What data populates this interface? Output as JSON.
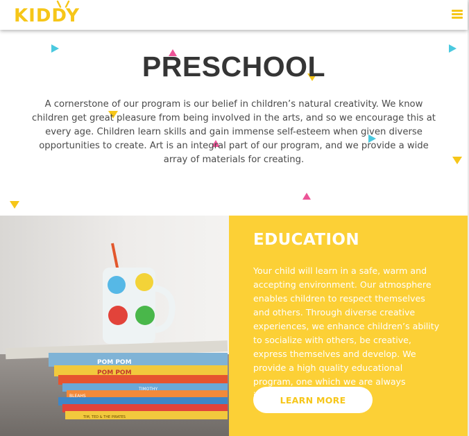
{
  "header": {
    "logo_text": "KIDDY",
    "menu_icon": "hamburger-menu-icon",
    "brand_color": "#f6c619"
  },
  "intro": {
    "title": "PRESCHOOL",
    "body": "A cornerstone of our program is our belief in children’s natural creativity. We know children get great pleasure from being involved in the arts, and so we encourage this at every age. Children learn skills and gain immense self-esteem when given diverse opportunities to create. Art is an integral part of our program, and we provide a wide array of materials for creating."
  },
  "education": {
    "title": "EDUCATION",
    "body": "Your child will learn in a safe, warm and accepting environment. Our atmosphere enables children to respect themselves and others. Through diverse creative experiences, we enhance children’s ability to socialize with others, be creative, express themselves and develop. We provide a high quality educational program, one which we are always improving.",
    "button_label": "LEARN MORE",
    "panel_color": "#fcd036",
    "photo_alt": "mug with colorful faces on stack of children's books",
    "book_spines": [
      "POM POM",
      "POM POM",
      "TIMOTHY",
      "BLEAHS",
      "TIM, TED & THE PIRATES"
    ]
  },
  "decor": {
    "colors": {
      "teal": "#4ac9df",
      "yellow": "#f6c619",
      "pink": "#ec5497"
    }
  }
}
